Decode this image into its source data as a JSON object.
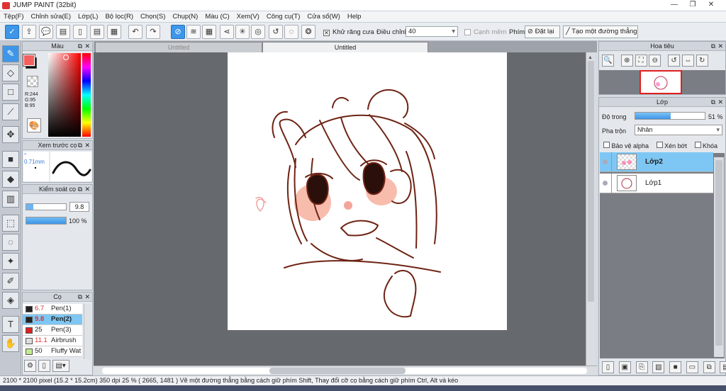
{
  "window": {
    "title": "JUMP PAINT (32bit)"
  },
  "menu": [
    "Tệp(F)",
    "Chỉnh sửa(E)",
    "Lớp(L)",
    "Bộ lọc(R)",
    "Chọn(S)",
    "Chụp(N)",
    "Màu (C)",
    "Xem(V)",
    "Công cụ(T)",
    "Cửa sổ(W)",
    "Help"
  ],
  "toolbar": {
    "antialias_label": "Khử răng cưa",
    "adjust_label": "Điều chỉnh",
    "adjust_value": "40",
    "edge_label": "Cạnh mềm",
    "key_label": "Phím",
    "reset_label": "Đặt lại",
    "straight_line_label": "Tạo một đường thẳng"
  },
  "tabs": [
    "Untitled",
    "Untitled"
  ],
  "color_panel": {
    "title": "Màu",
    "r": "R:244",
    "g": "G:95",
    "b": "B:95",
    "fg": "#f45f5f",
    "bg": "#000000"
  },
  "brush_preview": {
    "title": "Xem trước cọ",
    "size": "° 0.71mm"
  },
  "brush_control": {
    "title": "Kiểm soát cọ",
    "size_value": "9.8",
    "opacity_value": "100 %"
  },
  "brush_list": {
    "title": "Cọ",
    "items": [
      {
        "size": "6.7",
        "name": "Pen(1)",
        "color": "#222222"
      },
      {
        "size": "9.8",
        "name": "Pen(2)",
        "color": "#222222"
      },
      {
        "size": "25",
        "name": "Pen(3)",
        "color": "#e02020"
      },
      {
        "size": "11.1",
        "name": "Airbrush",
        "color": "#dddddd"
      },
      {
        "size": "50",
        "name": "Fluffy Wat",
        "color": "#c4ec90"
      }
    ]
  },
  "navigator": {
    "title": "Hoa tiêu"
  },
  "layers": {
    "title": "Lớp",
    "opacity_label": "Độ trong",
    "opacity_value": "51 %",
    "blend_label": "Pha trộn",
    "blend_value": "Nhân",
    "protect_alpha": "Bảo vệ alpha",
    "clip": "Xén bớt",
    "lock": "Khóa",
    "items": [
      {
        "name": "Lớp2"
      },
      {
        "name": "Lớp1"
      }
    ]
  },
  "status": "2100 * 2100 pixel   (15.2 * 15.2cm)   350 dpi   25 %   ( 2665, 1481 )   Vẽ một đường thẳng bằng cách giữ phím Shift, Thay đổi cỡ cọ bằng cách giữ phím Ctrl, Alt và kéo"
}
